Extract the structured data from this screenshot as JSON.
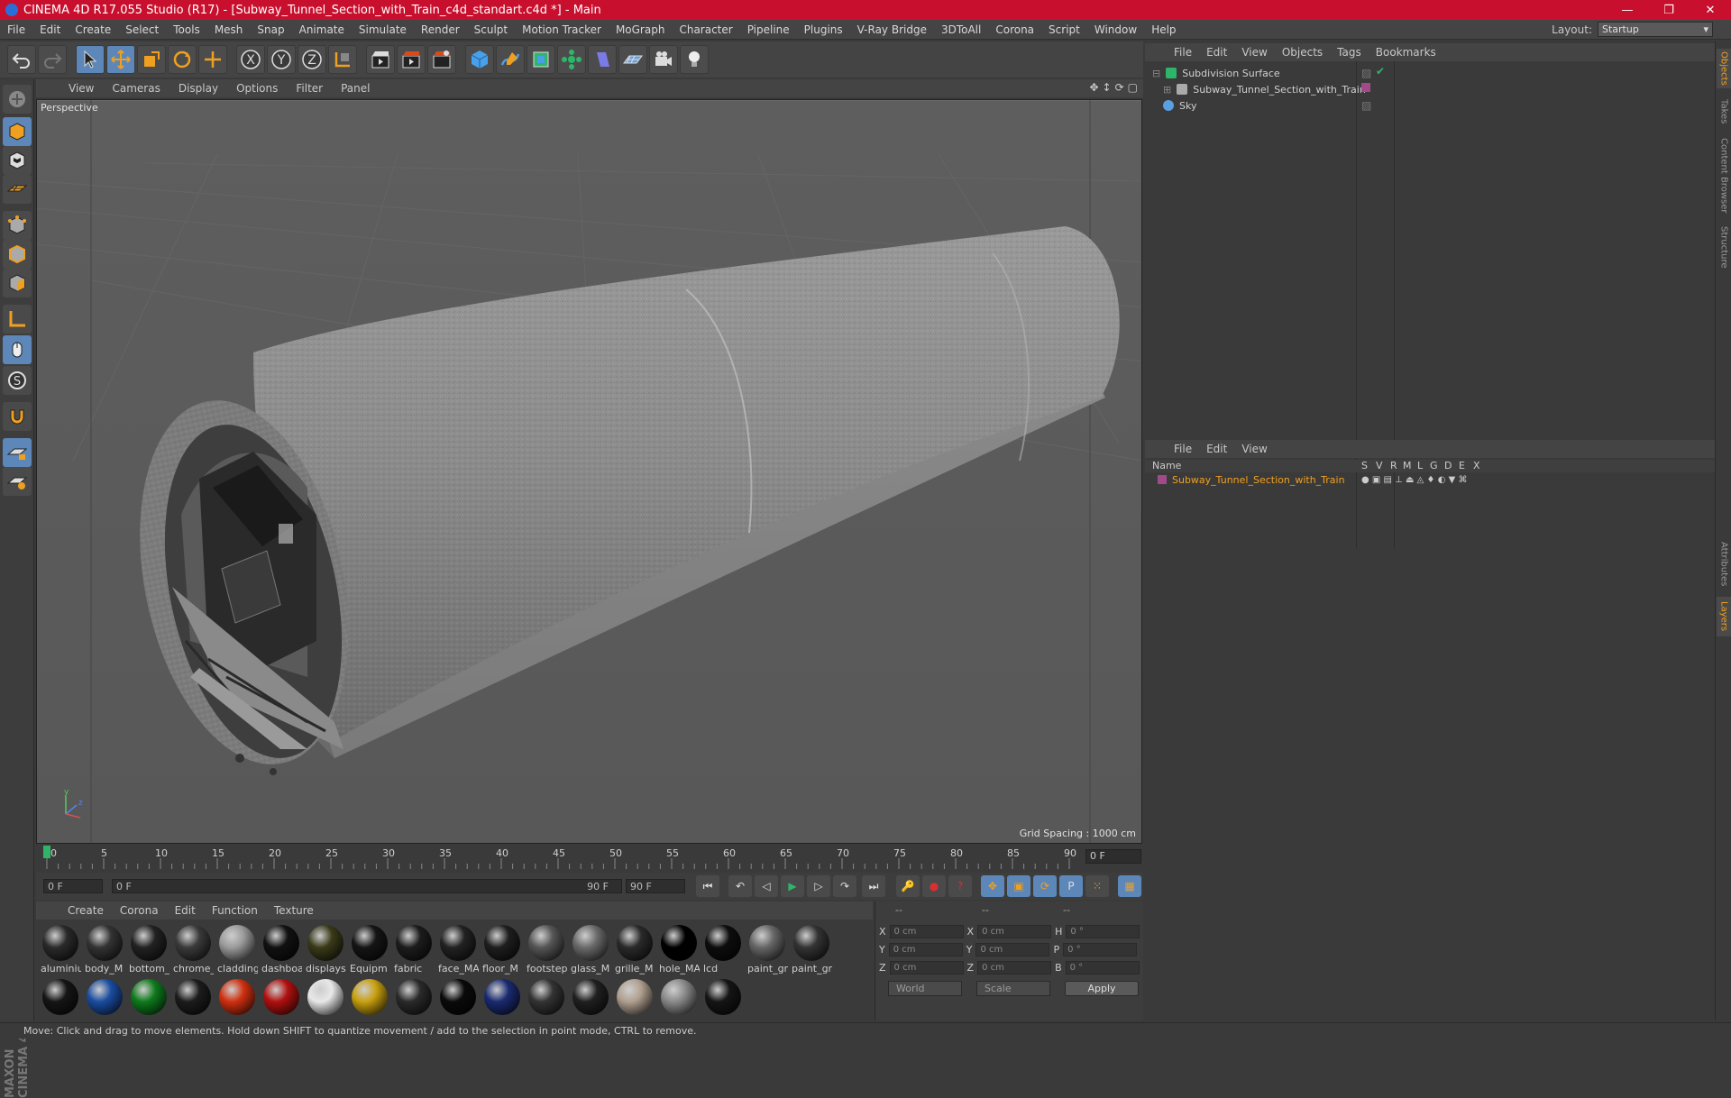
{
  "window": {
    "title": "CINEMA 4D R17.055 Studio (R17) - [Subway_Tunnel_Section_with_Train_c4d_standart.c4d *] - Main",
    "minimize": "—",
    "restore": "❐",
    "close": "✕"
  },
  "menubar": {
    "items": [
      "File",
      "Edit",
      "Create",
      "Select",
      "Tools",
      "Mesh",
      "Snap",
      "Animate",
      "Simulate",
      "Render",
      "Sculpt",
      "Motion Tracker",
      "MoGraph",
      "Character",
      "Pipeline",
      "Plugins",
      "V-Ray Bridge",
      "3DToAll",
      "Corona",
      "Script",
      "Window",
      "Help"
    ],
    "layout_label": "Layout:",
    "layout_value": "Startup"
  },
  "viewport": {
    "menu": [
      "View",
      "Cameras",
      "Display",
      "Options",
      "Filter",
      "Panel"
    ],
    "label": "Perspective",
    "grid_spacing": "Grid Spacing : 1000 cm"
  },
  "timeline": {
    "ticks": [
      "0",
      "5",
      "10",
      "15",
      "20",
      "25",
      "30",
      "35",
      "40",
      "45",
      "50",
      "55",
      "60",
      "65",
      "70",
      "75",
      "80",
      "85",
      "90"
    ],
    "current_frame": "0 F"
  },
  "transport": {
    "start": "0 F",
    "range_start": "0 F",
    "range_end": "90 F",
    "end": "90 F"
  },
  "materials": {
    "menu": [
      "Create",
      "Corona",
      "Edit",
      "Function",
      "Texture"
    ],
    "row1": [
      {
        "label": "aluminiu",
        "color": "#2a2a2a"
      },
      {
        "label": "body_M",
        "color": "#333333"
      },
      {
        "label": "bottom_",
        "color": "#222222"
      },
      {
        "label": "chrome_",
        "color": "#3a3a3a"
      },
      {
        "label": "cladding",
        "color": "#9a9a9a"
      },
      {
        "label": "dashboa",
        "color": "#111111"
      },
      {
        "label": "displays",
        "color": "#3a3a1a"
      },
      {
        "label": "Equipm",
        "color": "#151515"
      },
      {
        "label": "fabric",
        "color": "#1c1c1c"
      },
      {
        "label": "face_MA",
        "color": "#222222"
      },
      {
        "label": "floor_M",
        "color": "#1e1e1e"
      },
      {
        "label": "footstep",
        "color": "#555555"
      },
      {
        "label": "glass_M",
        "color": "#6a6a6a"
      },
      {
        "label": "grille_M",
        "color": "#2a2a2a"
      },
      {
        "label": "hole_MA",
        "color": "#000000"
      },
      {
        "label": "lcd",
        "color": "#0d0d0d"
      },
      {
        "label": "paint_gr",
        "color": "#666666"
      },
      {
        "label": "paint_gr",
        "color": "#333333"
      }
    ],
    "row2": [
      {
        "color": "#151515"
      },
      {
        "color": "#1a4ca0"
      },
      {
        "color": "#0e7a1c"
      },
      {
        "color": "#1c1c1c"
      },
      {
        "color": "#d03010"
      },
      {
        "color": "#b01010"
      },
      {
        "color": "#e8e8e8"
      },
      {
        "color": "#c8a010"
      },
      {
        "color": "#2a2a2a"
      },
      {
        "color": "#0a0a0a"
      },
      {
        "color": "#1a2a70"
      },
      {
        "color": "#333333"
      },
      {
        "color": "#202020"
      },
      {
        "color": "#b0a090"
      },
      {
        "color": "#8a8a8a"
      },
      {
        "color": "#151515"
      }
    ]
  },
  "coords": {
    "header1": "--",
    "header2": "--",
    "header3": "--",
    "rows": [
      {
        "a": "X",
        "av": "0 cm",
        "b": "X",
        "bv": "0 cm",
        "c": "H",
        "cv": "0 °"
      },
      {
        "a": "Y",
        "av": "0 cm",
        "b": "Y",
        "bv": "0 cm",
        "c": "P",
        "cv": "0 °"
      },
      {
        "a": "Z",
        "av": "0 cm",
        "b": "Z",
        "bv": "0 cm",
        "c": "B",
        "cv": "0 °"
      }
    ],
    "mode1": "World",
    "mode2": "Scale",
    "apply": "Apply"
  },
  "objects": {
    "menu": [
      "File",
      "Edit",
      "View",
      "Objects",
      "Tags",
      "Bookmarks"
    ],
    "items": [
      {
        "name": "Subdivision Surface",
        "icon": "#2fb56a"
      },
      {
        "name": "Subway_Tunnel_Section_with_Train",
        "icon": "#aaaaaa"
      },
      {
        "name": "Sky",
        "icon": "#5aa0e0"
      }
    ]
  },
  "layers": {
    "menu": [
      "File",
      "Edit",
      "View"
    ],
    "cols": [
      "Name",
      "S",
      "V",
      "R",
      "M",
      "L",
      "G",
      "D",
      "E",
      "X"
    ],
    "row": "Subway_Tunnel_Section_with_Train"
  },
  "sidetabs": [
    "Objects",
    "Takes",
    "Content Browser",
    "Structure",
    "Attributes",
    "Layers"
  ],
  "status": "Move: Click and drag to move elements. Hold down SHIFT to quantize movement / add to the selection in point mode, CTRL to remove."
}
